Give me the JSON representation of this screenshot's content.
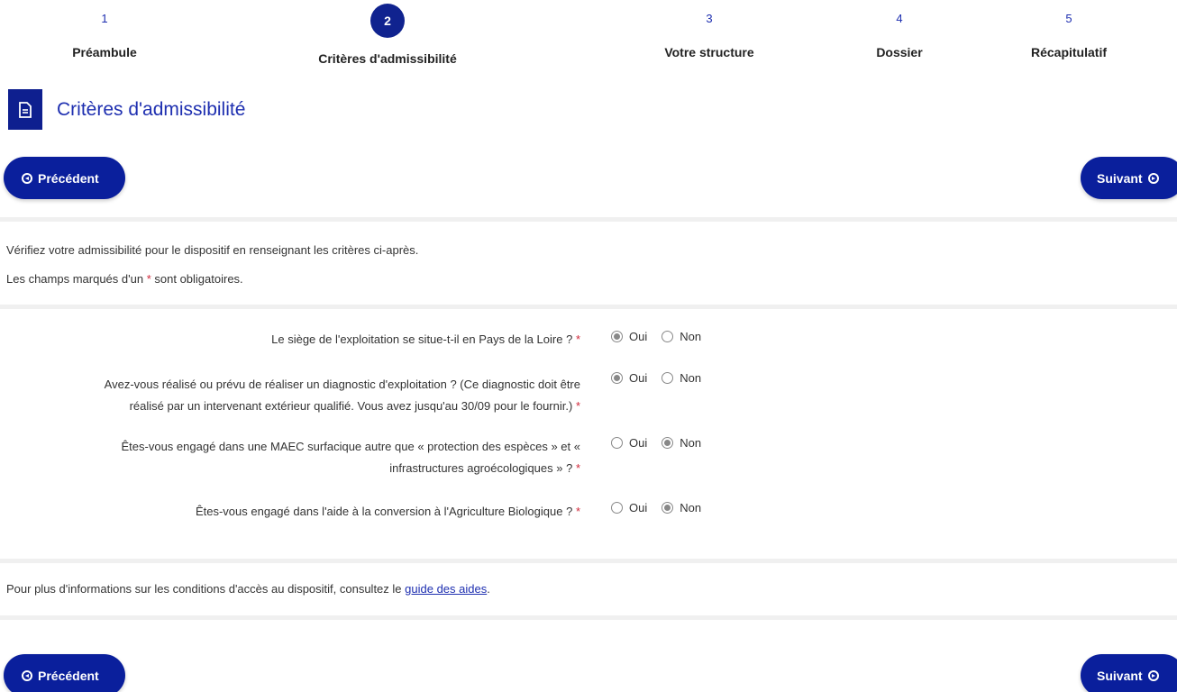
{
  "stepper": {
    "steps": [
      {
        "number": "1",
        "label": "Préambule"
      },
      {
        "number": "2",
        "label": "Critères d'admissibilité"
      },
      {
        "number": "3",
        "label": "Votre structure"
      },
      {
        "number": "4",
        "label": "Dossier"
      },
      {
        "number": "5",
        "label": "Récapitulatif"
      }
    ],
    "active_step": 2
  },
  "section": {
    "icon": "document-icon",
    "title": "Critères d'admissibilité"
  },
  "nav": {
    "prev_label": "Précédent",
    "next_label": "Suivant"
  },
  "intro": {
    "line1": "Vérifiez votre admissibilité pour le dispositif en renseignant les critères ci-après.",
    "line2_before": "Les champs marqués d'un",
    "required_marker": "*",
    "line2_after": "sont obligatoires."
  },
  "questions": [
    {
      "label_lines": [
        "Le siège de l'exploitation se situe-t-il en Pays de la Loire ?"
      ],
      "options": [
        "Oui",
        "Non"
      ],
      "selected": "Oui"
    },
    {
      "label_lines": [
        "Avez-vous réalisé ou prévu de réaliser un diagnostic d'exploitation ? (Ce diagnostic doit être",
        "réalisé par un intervenant extérieur qualifié. Vous avez jusqu'au 30/09 pour le fournir.)"
      ],
      "options": [
        "Oui",
        "Non"
      ],
      "selected": "Oui"
    },
    {
      "label_lines": [
        "Êtes-vous engagé dans une MAEC surfacique autre que « protection des espèces » et «",
        "infrastructures agroécologiques » ?"
      ],
      "options": [
        "Oui",
        "Non"
      ],
      "selected": "Non"
    },
    {
      "label_lines": [
        "Êtes-vous engagé dans l'aide à la conversion à l'Agriculture Biologique ?"
      ],
      "options": [
        "Oui",
        "Non"
      ],
      "selected": "Non"
    }
  ],
  "footer": {
    "text_before": "Pour plus d'informations sur les conditions d'accès au dispositif, consultez le",
    "link_label": "guide des aides",
    "text_after": "."
  },
  "colors": {
    "primary": "#0a1f9c",
    "accent_text": "#1e2fb0",
    "required": "#d0293b"
  }
}
